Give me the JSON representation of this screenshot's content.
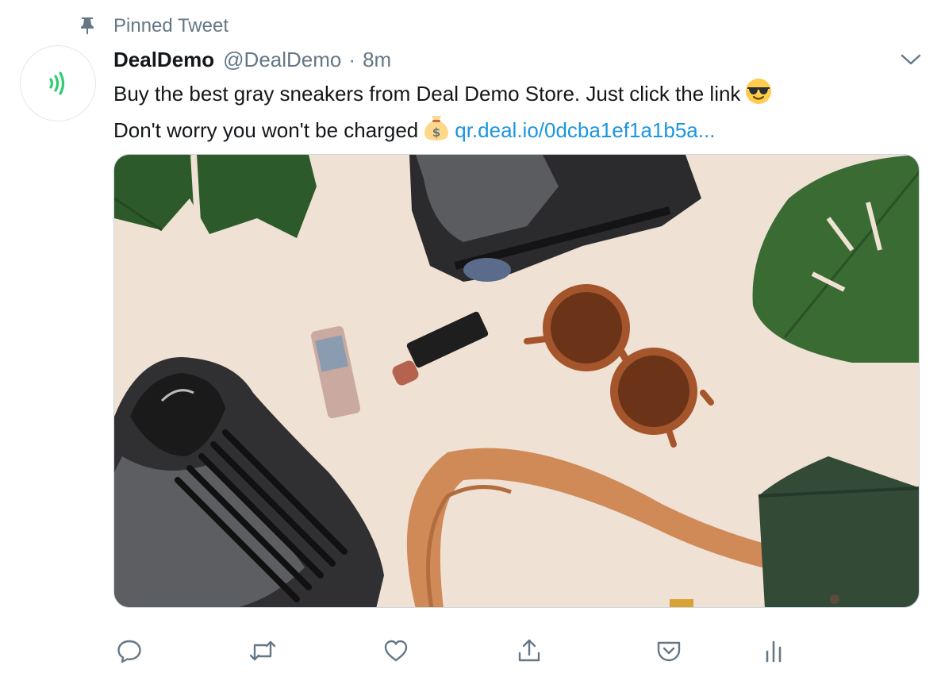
{
  "pinned": {
    "label": "Pinned Tweet",
    "icon": "pin-icon"
  },
  "author": {
    "display_name": "DealDemo",
    "handle": "@DealDemo",
    "separator": "·",
    "time": "8m",
    "avatar_icon": "contactless-signal-icon",
    "avatar_color": "#2ecc71"
  },
  "tweet": {
    "line1": "Buy the best gray sneakers from Deal Demo Store. Just click the link",
    "line1_emoji": "sunglasses-face-emoji",
    "line2": "Don't worry you won't be charged",
    "line2_emoji": "money-bag-emoji",
    "link": "qr.deal.io/0dcba1ef1a1b5a..."
  },
  "media": {
    "alt": "Flat lay photo of gray knit sneakers, lipsticks, tortoiseshell sunglasses, leather bag and monstera leaves"
  },
  "actions": [
    {
      "name": "reply",
      "icon": "reply-icon"
    },
    {
      "name": "retweet",
      "icon": "retweet-icon"
    },
    {
      "name": "like",
      "icon": "heart-icon"
    },
    {
      "name": "share",
      "icon": "share-icon"
    },
    {
      "name": "pocket",
      "icon": "pocket-icon"
    },
    {
      "name": "analytics",
      "icon": "analytics-icon"
    }
  ],
  "colors": {
    "text_primary": "#14171a",
    "text_secondary": "#657786",
    "link": "#1b95e0",
    "icon": "#657786"
  }
}
